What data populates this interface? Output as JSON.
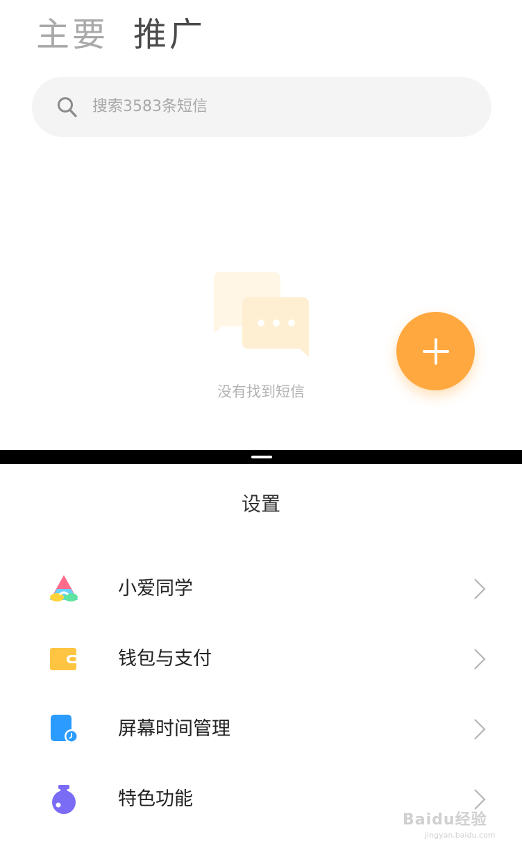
{
  "tabs": [
    {
      "label": "主要",
      "active": false
    },
    {
      "label": "推广",
      "active": true
    }
  ],
  "search": {
    "placeholder": "搜索3583条短信",
    "icon": "search-icon"
  },
  "empty_state": {
    "text": "没有找到短信",
    "icon": "chat-bubbles-icon"
  },
  "fab": {
    "icon": "plus-icon",
    "color": "#ffa83f"
  },
  "settings": {
    "title": "设置",
    "items": [
      {
        "label": "小爱同学",
        "icon": "xiaoai-icon"
      },
      {
        "label": "钱包与支付",
        "icon": "wallet-icon"
      },
      {
        "label": "屏幕时间管理",
        "icon": "screen-time-icon"
      },
      {
        "label": "特色功能",
        "icon": "feature-flask-icon"
      }
    ]
  },
  "watermark": {
    "text": "Baidu经验",
    "sub": "jingyan.baidu.com"
  }
}
